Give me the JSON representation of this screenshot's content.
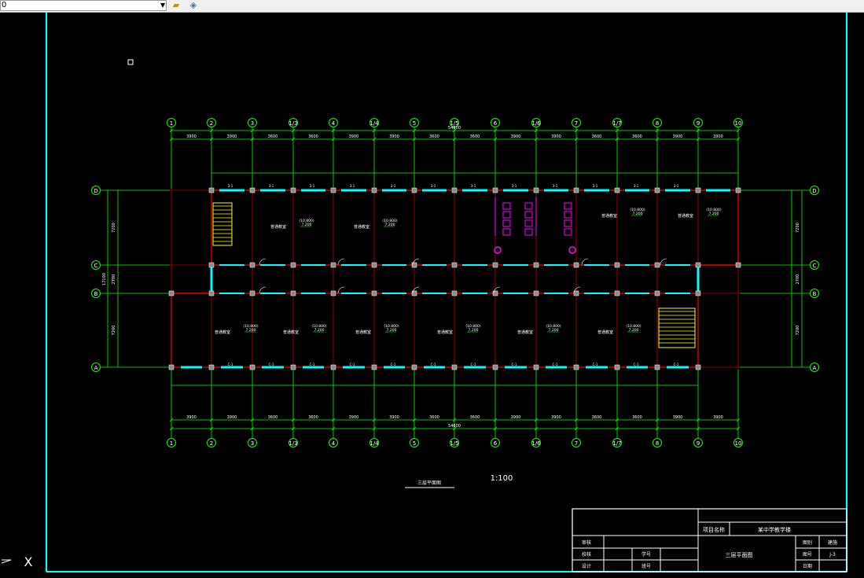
{
  "toolbar": {
    "layer_value": "0",
    "layer_properties_icon": "layer-properties-icon",
    "layer_state_icon": "layer-state-icon"
  },
  "colors": {
    "background": "#000000",
    "frame": "#00ffff",
    "axis": "#00ff00",
    "wall": "#ff0000",
    "window": "#00ffff",
    "text": "#ffffff",
    "fixture": "#ff00ff",
    "stair": "#ffff00"
  },
  "drawing": {
    "axes_top": [
      "1",
      "2",
      "3",
      "1/3",
      "4",
      "1/4",
      "5",
      "1/5",
      "6",
      "1/6",
      "7",
      "1/7",
      "8",
      "9",
      "10"
    ],
    "axes_side": [
      "D",
      "C",
      "B",
      "A"
    ],
    "overall_length": "54600",
    "bay_dims_top": [
      "3900",
      "3900",
      "3600",
      "3600",
      "3900",
      "3900",
      "3600",
      "3600",
      "3900",
      "3900",
      "3600",
      "3600",
      "3900",
      "3900"
    ],
    "bay_dims_bottom": [
      "3900",
      "3900",
      "3600",
      "3600",
      "3900",
      "3900",
      "3600",
      "3600",
      "3900",
      "3900",
      "3600",
      "3600",
      "3900",
      "3900"
    ],
    "side_dims": [
      "7200",
      "2700",
      "7200"
    ],
    "side_total": "17100",
    "room_label": "普通教室",
    "room_elev": "(10.800)",
    "room_elev2": "7.200",
    "plan_title": "三层平面图",
    "scale": "1:100",
    "small_label_top": "3-1",
    "small_label_bot": "C-1"
  },
  "title_block": {
    "project_label": "项目名称",
    "project_name": "某中学教学楼",
    "drawing_name": "三层平面图",
    "row_labels": [
      "审核",
      "校核",
      "设计"
    ],
    "col_labels": [
      "学号",
      "班号"
    ],
    "right_labels": [
      "图别",
      "图号",
      "日期"
    ],
    "right_values": [
      "建施",
      "J-3",
      ""
    ]
  },
  "ucs": {
    "x_label": "X"
  }
}
